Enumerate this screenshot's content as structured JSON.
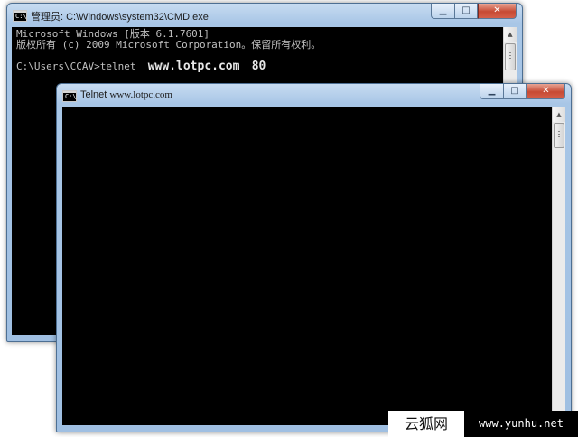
{
  "cmd_window": {
    "title": "管理员: C:\\Windows\\system32\\CMD.exe",
    "icon": "console-icon",
    "icon_text": "C:\\",
    "lines": [
      "Microsoft Windows [版本 6.1.7601]",
      "版权所有 (c) 2009 Microsoft Corporation。保留所有权利。"
    ],
    "prompt": "C:\\Users\\CCAV>telnet",
    "host": "www.lotpc.com",
    "port": "80"
  },
  "telnet_window": {
    "title_prefix": "Telnet",
    "title_host": "www.lotpc.com",
    "icon": "console-icon",
    "icon_text": "C:\\"
  },
  "controls": {
    "minimize": "▁",
    "maximize": "□",
    "close": "✕",
    "scroll_up": "▲",
    "scroll_down": "▼"
  },
  "watermark": {
    "left": "云狐网",
    "right": "www.yunhu.net"
  }
}
